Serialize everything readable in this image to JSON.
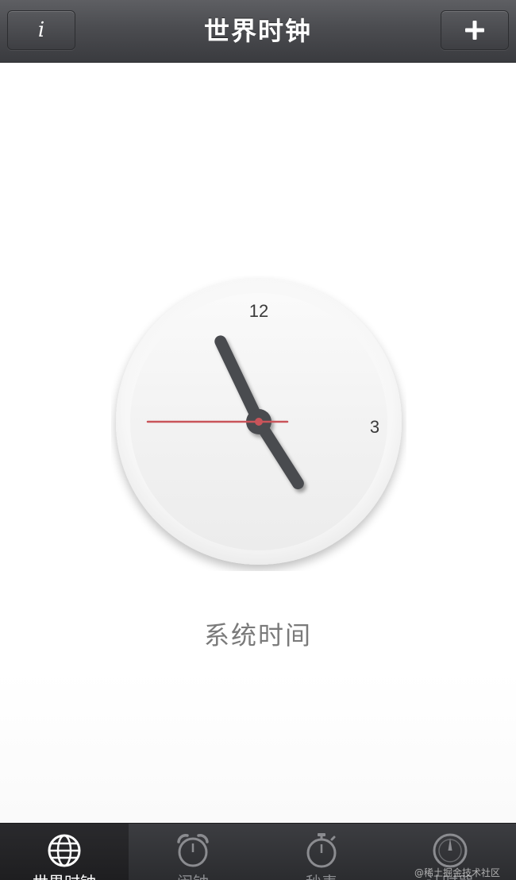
{
  "navbar": {
    "title": "世界时钟",
    "info_label": "i",
    "add_label": "+"
  },
  "clock": {
    "label": "系统时间",
    "numerals": {
      "twelve": "12",
      "three": "3"
    },
    "time": {
      "hour": 4,
      "minute": 55,
      "second": 45
    },
    "colors": {
      "hands": "#4a4b4f",
      "second_hand": "#c9545a",
      "face": "#f2f2f2",
      "rim": "#f9f9f9"
    }
  },
  "tabbar": {
    "items": [
      {
        "label": "世界时钟",
        "icon": "globe-icon",
        "active": true
      },
      {
        "label": "闹钟",
        "icon": "alarm-clock-icon",
        "active": false
      },
      {
        "label": "秒表",
        "icon": "stopwatch-icon",
        "active": false
      },
      {
        "label": "计时器",
        "icon": "timer-icon",
        "active": false
      }
    ]
  },
  "watermark": "@稀土掘金技术社区"
}
